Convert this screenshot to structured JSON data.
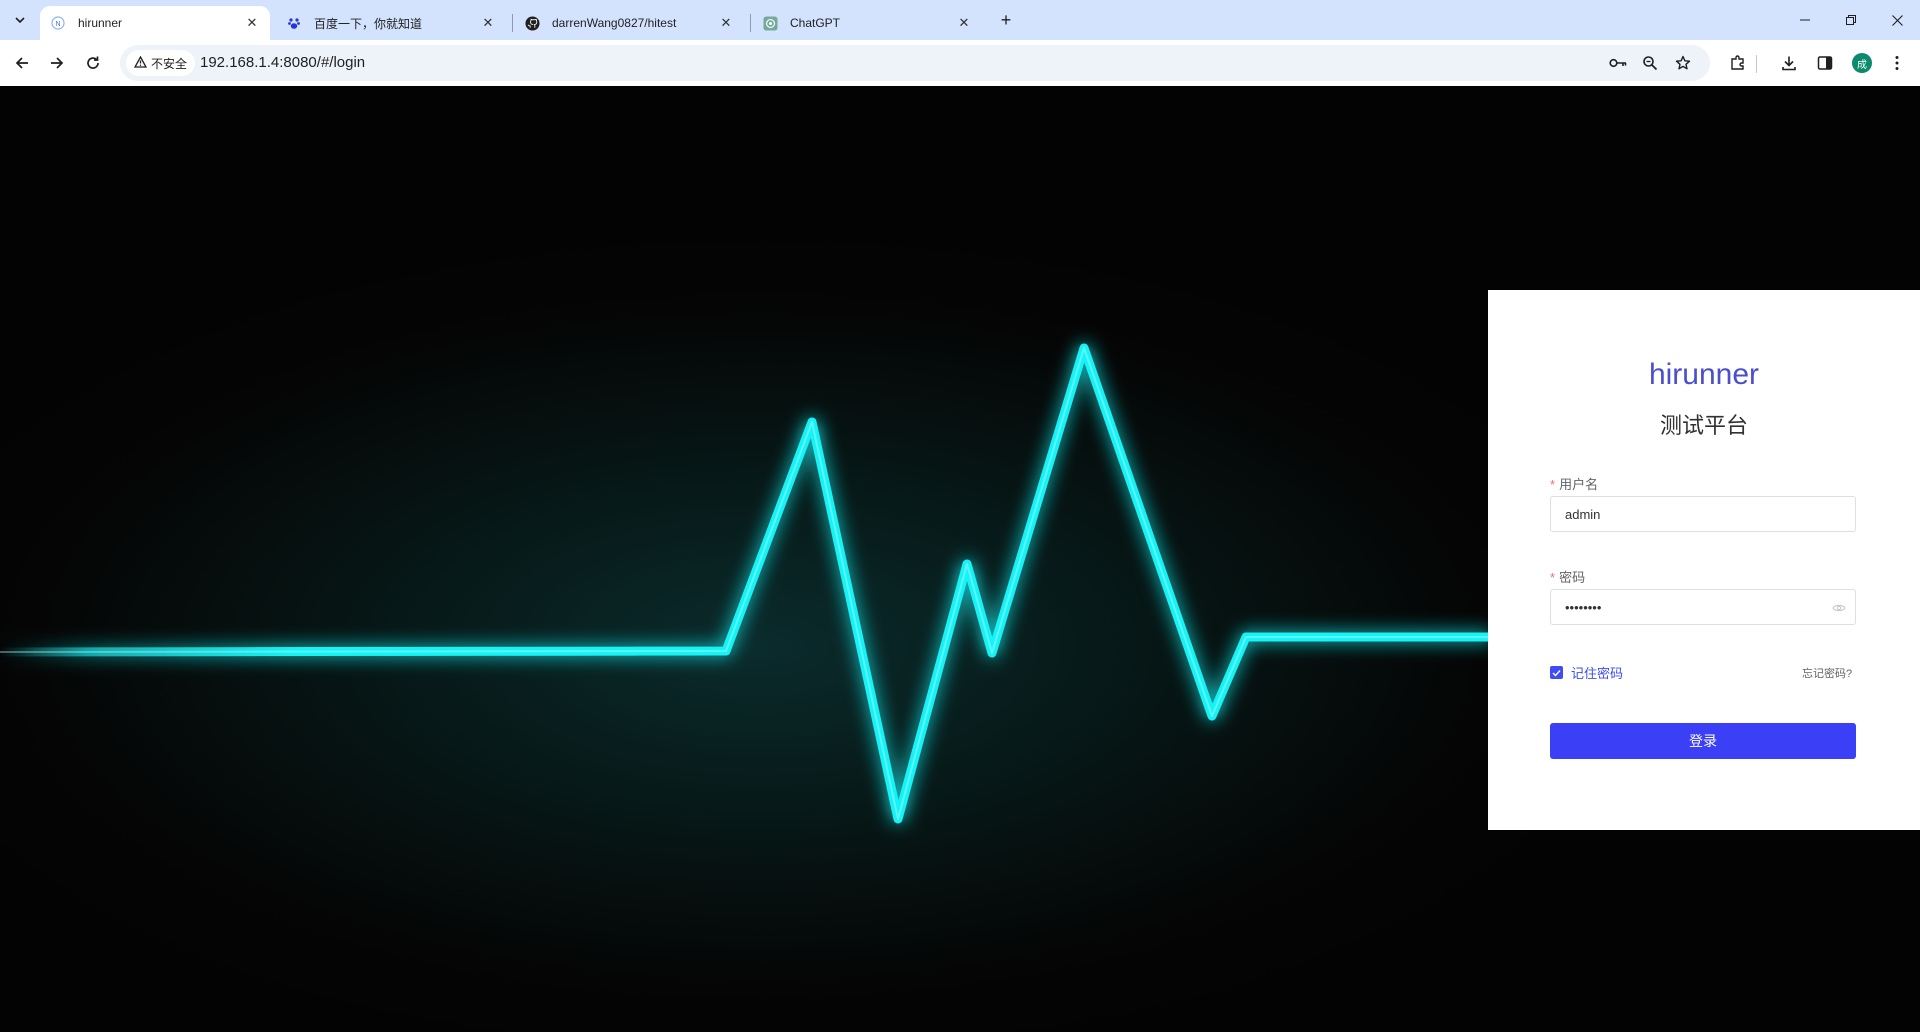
{
  "browser": {
    "tabs": [
      {
        "title": "hirunner",
        "active": true
      },
      {
        "title": "百度一下，你就知道",
        "active": false
      },
      {
        "title": "darrenWang0827/hitest",
        "active": false
      },
      {
        "title": "ChatGPT",
        "active": false
      }
    ],
    "security_label": "不安全",
    "url": "192.168.1.4:8080/#/login",
    "profile_initial": "成"
  },
  "login": {
    "brand": "hirunner",
    "subtitle": "测试平台",
    "username_label": "用户名",
    "username_value": "admin",
    "password_label": "密码",
    "password_value": "12345678",
    "remember_label": "记住密码",
    "remember_checked": true,
    "forgot_label": "忘记密码?",
    "submit_label": "登录",
    "accent_color": "#3b3ff5",
    "brand_color": "#4a4ecf"
  },
  "background": {
    "pulse_color": "#19f2f5"
  }
}
